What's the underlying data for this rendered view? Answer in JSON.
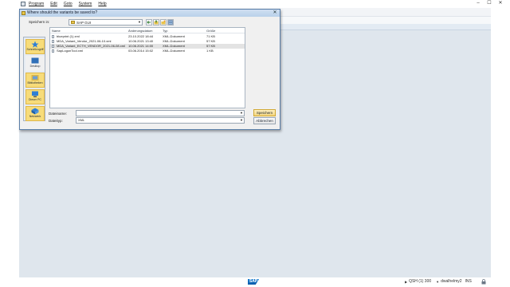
{
  "menu": {
    "items": [
      "Program",
      "Edit",
      "Goto",
      "System",
      "Help"
    ]
  },
  "dialog": {
    "title": "Where should the variants be saved to?",
    "look_in_label": "Speichern in:",
    "look_in_value": "SAP GUI",
    "places": [
      {
        "label": "Schnellzugriff",
        "icon": "quick-access-icon"
      },
      {
        "label": "Desktop",
        "icon": "desktop-icon"
      },
      {
        "label": "Bibliotheken",
        "icon": "libraries-icon"
      },
      {
        "label": "Dieser PC",
        "icon": "this-pc-icon"
      },
      {
        "label": "Netzwerk",
        "icon": "network-icon"
      }
    ],
    "columns": {
      "name": "Name",
      "date": "Änderungsdatum",
      "type": "Typ",
      "size": "Größe"
    },
    "files": [
      {
        "name": "blueprint (1).xml",
        "date": "23.10.2022 18:44",
        "type": "XML-Dokument",
        "size": "71 KB"
      },
      {
        "name": "MDA_Variant_Vendor_2021-06-10.xml",
        "date": "10.06.2021 13:40",
        "type": "XML-Dokument",
        "size": "57 KB"
      },
      {
        "name": "MDA_Variant_ECTH_VENDOR_2021-06-08.xml",
        "date": "10.06.2021 14:00",
        "type": "XML-Dokument",
        "size": "57 KB"
      },
      {
        "name": "SapLogonTool.xml",
        "date": "03.06.2014 15:02",
        "type": "XML-Dokument",
        "size": "1 KB"
      }
    ],
    "selected_index": 2,
    "filename_label": "Dateiname:",
    "filename_value": "",
    "filetype_label": "Dateityp:",
    "filetype_value": "XML",
    "save_label": "Speichern",
    "cancel_label": "Abbrechen"
  },
  "status": {
    "system": "QSH (1) 300",
    "user": "dwalhelmy2",
    "mode": "INS"
  },
  "colors": {
    "app_background": "#dfe6ed",
    "dialog_border": "#5a7ea8",
    "place_highlight": "#f7dc7a",
    "primary_button": "#f3d57f"
  }
}
